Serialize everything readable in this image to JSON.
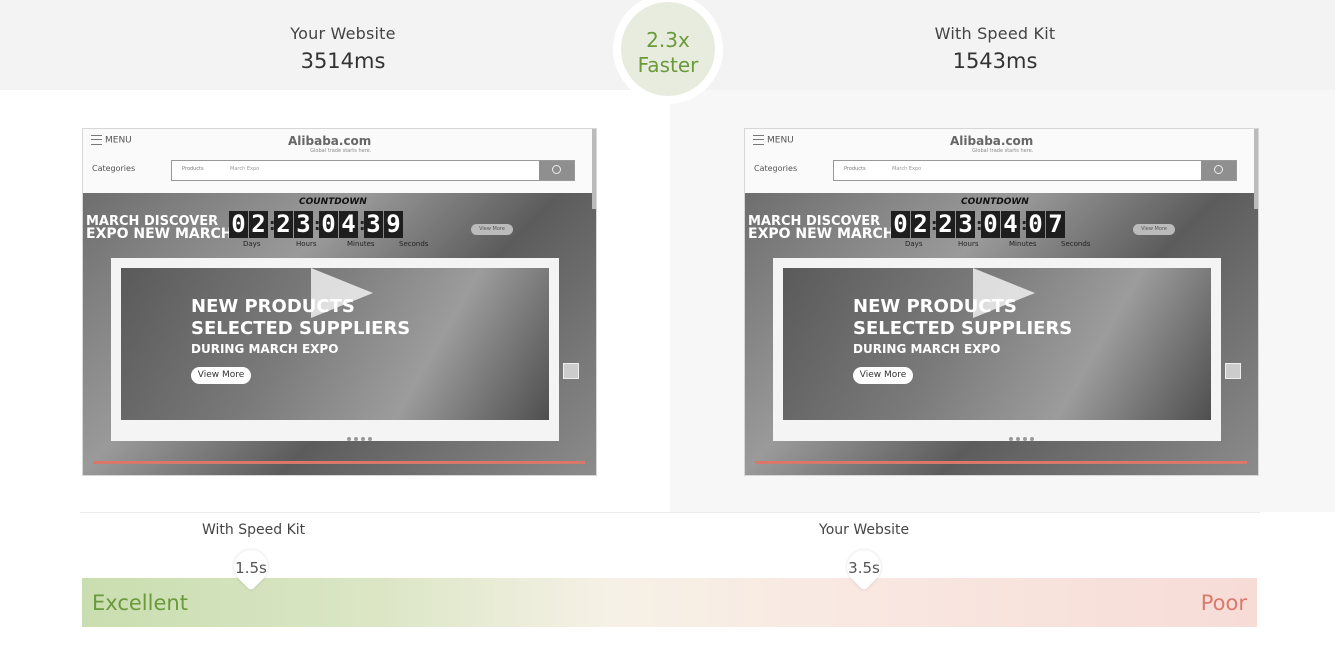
{
  "header": {
    "left_label": "Your Website",
    "left_value": "3514ms",
    "right_label": "With Speed Kit",
    "right_value": "1543ms",
    "badge_line1": "2.3x",
    "badge_line2": "Faster"
  },
  "screenshots": [
    {
      "menu": "MENU",
      "logo": "Alibaba.com",
      "logo_sub": "Global trade starts here.",
      "categories": "Categories",
      "search_category": "Products",
      "search_text": "March Expo",
      "banner_line1": "MARCH DISCOVER",
      "banner_line2": "EXPO NEW MARCH",
      "countdown_title": "COUNTDOWN",
      "digits": [
        "0",
        "2",
        "2",
        "3",
        "0",
        "4",
        "3",
        "9"
      ],
      "units": [
        "Days",
        "Hours",
        "Minutes",
        "Seconds"
      ],
      "view_more_small": "View More",
      "headline1": "NEW PRODUCTS",
      "headline2": "SELECTED SUPPLIERS",
      "headline3": "DURING MARCH EXPO",
      "view_more": "View More"
    },
    {
      "menu": "MENU",
      "logo": "Alibaba.com",
      "logo_sub": "Global trade starts here.",
      "categories": "Categories",
      "search_category": "Products",
      "search_text": "March Expo",
      "banner_line1": "MARCH DISCOVER",
      "banner_line2": "EXPO NEW MARCH",
      "countdown_title": "COUNTDOWN",
      "digits": [
        "0",
        "2",
        "2",
        "3",
        "0",
        "4",
        "0",
        "7"
      ],
      "units": [
        "Days",
        "Hours",
        "Minutes",
        "Seconds"
      ],
      "view_more_small": "View More",
      "headline1": "NEW PRODUCTS",
      "headline2": "SELECTED SUPPLIERS",
      "headline3": "DURING MARCH EXPO",
      "view_more": "View More"
    }
  ],
  "timeline": {
    "speedkit_label": "With Speed Kit",
    "speedkit_value": "1.5s",
    "website_label": "Your Website",
    "website_value": "3.5s",
    "scale_left": "Excellent",
    "scale_right": "Poor"
  },
  "colors": {
    "good": "#6a9a3a",
    "poor": "#d97a6c",
    "progress": "#d9776a"
  }
}
